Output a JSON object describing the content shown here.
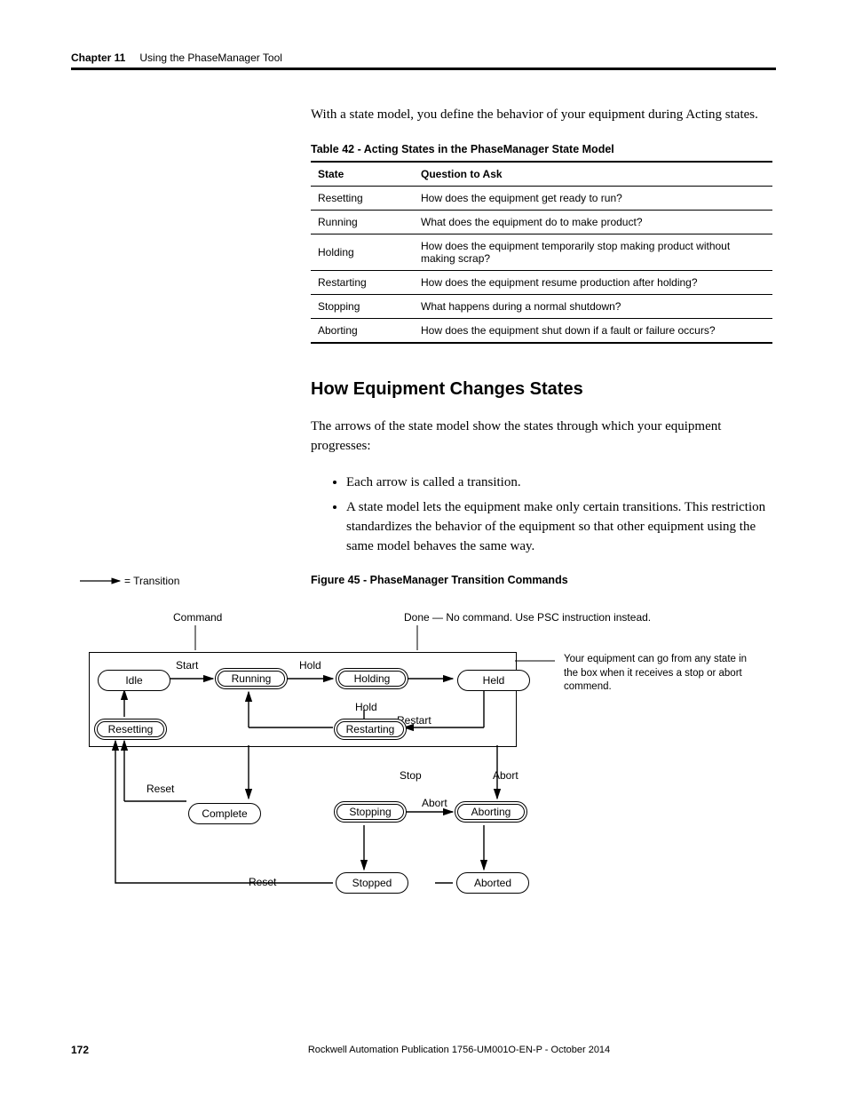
{
  "header": {
    "chapter": "Chapter 11",
    "title": "Using the PhaseManager Tool"
  },
  "intro_para": "With a state model, you define the behavior of your equipment during Acting states.",
  "table42": {
    "caption": "Table 42 - Acting States in the PhaseManager State Model",
    "head": {
      "c1": "State",
      "c2": "Question to Ask"
    },
    "rows": [
      {
        "c1": "Resetting",
        "c2": "How does the equipment get ready to run?"
      },
      {
        "c1": "Running",
        "c2": "What does the equipment do to make product?"
      },
      {
        "c1": "Holding",
        "c2": "How does the equipment temporarily stop making product without making scrap?"
      },
      {
        "c1": "Restarting",
        "c2": "How does the equipment resume production after holding?"
      },
      {
        "c1": "Stopping",
        "c2": "What happens during a normal shutdown?"
      },
      {
        "c1": "Aborting",
        "c2": "How does the equipment shut down if a fault or failure occurs?"
      }
    ]
  },
  "section_title": "How Equipment Changes States",
  "para2": "The arrows of the state model show the states through which your equipment progresses:",
  "bullets": [
    "Each arrow is called a transition.",
    "A state model lets the equipment make only certain transitions. This restriction standardizes the behavior of the equipment so that other equipment using the same model behaves the same way."
  ],
  "figure45": {
    "caption": "Figure 45 - PhaseManager Transition Commands",
    "legend": "= Transition",
    "top_labels": {
      "command": "Command",
      "done": "Done — No command. Use PSC instruction instead."
    },
    "annotation": "Your equipment can go from any state in the box when it receives a stop or abort commend.",
    "transitions": {
      "start": "Start",
      "hold1": "Hold",
      "hold2": "Hold",
      "restart": "Restart",
      "stop": "Stop",
      "abort1": "Abort",
      "abort2": "Abort",
      "reset1": "Reset",
      "reset2": "Reset"
    },
    "states": {
      "idle": "Idle",
      "running": "Running",
      "holding": "Holding",
      "held": "Held",
      "resetting": "Resetting",
      "restarting": "Restarting",
      "complete": "Complete",
      "stopping": "Stopping",
      "aborting": "Aborting",
      "stopped": "Stopped",
      "aborted": "Aborted"
    }
  },
  "footer": {
    "page": "172",
    "pub": "Rockwell Automation Publication 1756-UM001O-EN-P - October 2014"
  }
}
